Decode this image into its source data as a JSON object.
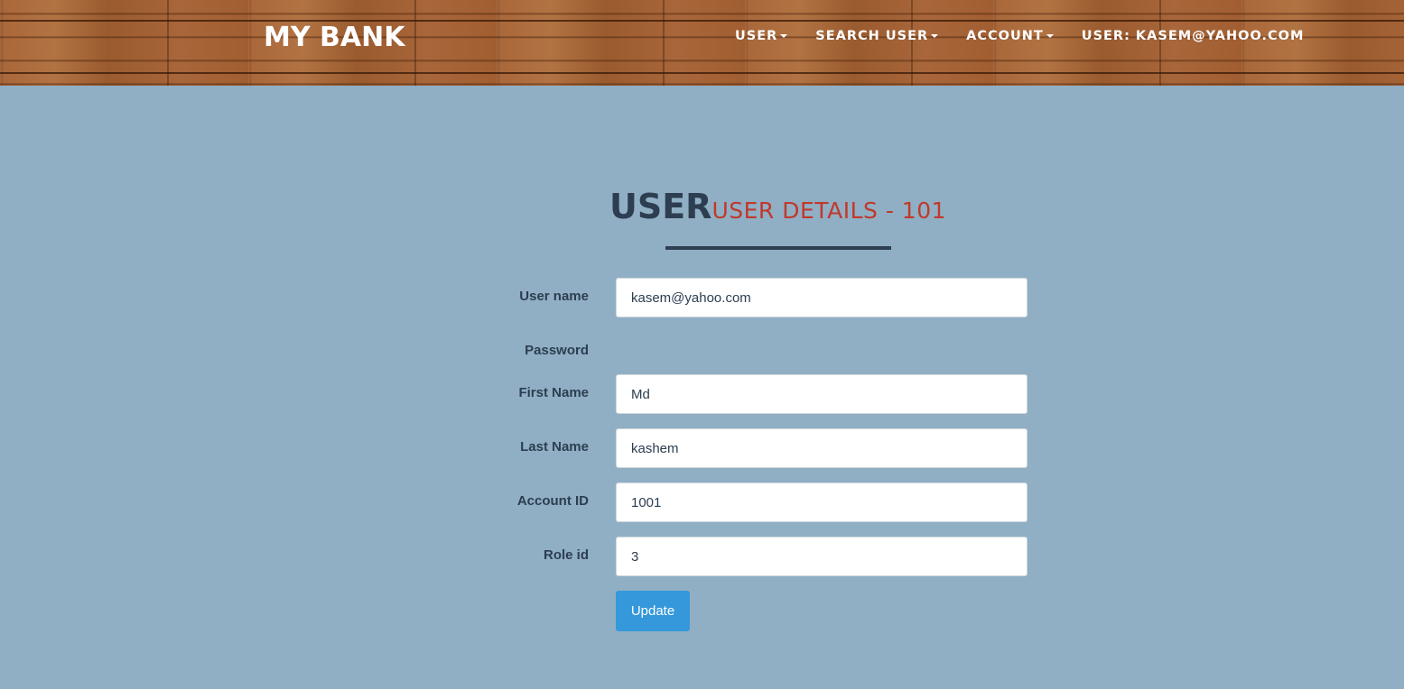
{
  "header": {
    "brand": "MY BANK",
    "nav": [
      {
        "label": "USER",
        "dropdown": true
      },
      {
        "label": "SEARCH USER",
        "dropdown": true
      },
      {
        "label": "ACCOUNT",
        "dropdown": true
      },
      {
        "label": "USER: KASEM@YAHOO.COM",
        "dropdown": false
      }
    ]
  },
  "page": {
    "title": "USER",
    "subtitle": "USER DETAILS - 101"
  },
  "form": {
    "username": {
      "label": "User name",
      "value": "kasem@yahoo.com"
    },
    "password": {
      "label": "Password"
    },
    "first_name": {
      "label": "First Name",
      "value": "Md"
    },
    "last_name": {
      "label": "Last Name",
      "value": "kashem"
    },
    "account_id": {
      "label": "Account ID",
      "value": "1001"
    },
    "role_id": {
      "label": "Role id",
      "value": "3"
    },
    "submit_label": "Update"
  },
  "colors": {
    "background": "#90afc5",
    "title": "#2c3e50",
    "subtitle": "#c0392b",
    "button": "#3498db"
  }
}
